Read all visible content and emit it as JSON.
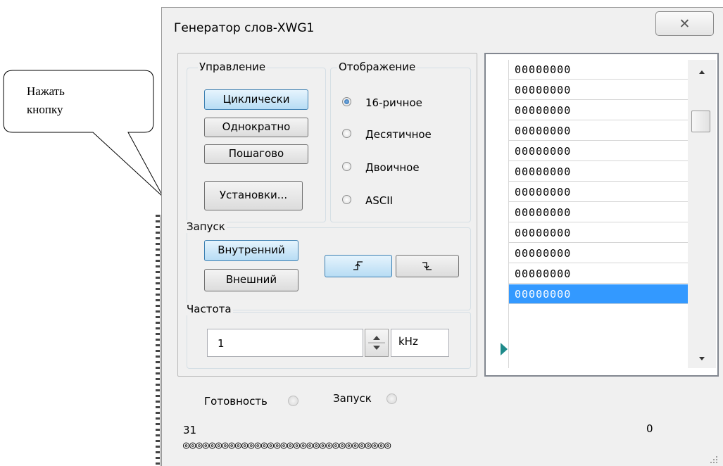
{
  "callout": {
    "line1": "Нажать",
    "line2": "кнопку"
  },
  "window": {
    "title": "Генератор слов-XWG1",
    "close_glyph": "✕"
  },
  "control": {
    "label": "Управление",
    "cyclic": "Циклически",
    "single": "Однократно",
    "step": "Пошагово",
    "settings": "Установки..."
  },
  "display": {
    "label": "Отображение",
    "options": [
      "16-ричное",
      "Десятичное",
      "Двоичное",
      "ASCII"
    ],
    "selected": "16-ричное"
  },
  "trigger": {
    "label": "Запуск",
    "internal": "Внутренний",
    "external": "Внешний",
    "rising_icon": "rising-edge-icon",
    "falling_icon": "falling-edge-icon"
  },
  "frequency": {
    "label": "Частота",
    "value": "1",
    "unit": "kHz"
  },
  "words": [
    "00000000",
    "00000000",
    "00000000",
    "00000000",
    "00000000",
    "00000000",
    "00000000",
    "00000000",
    "00000000",
    "00000000",
    "00000000",
    "00000000"
  ],
  "selected_row": 12,
  "status": {
    "ready": "Готовность",
    "trigger": "Запуск"
  },
  "bits": {
    "high": "31",
    "low": "0",
    "count": 32
  },
  "colors": {
    "selection": "#3399ff",
    "active_button": "#b7dcf4",
    "row_marker": "#1e8a8a"
  }
}
